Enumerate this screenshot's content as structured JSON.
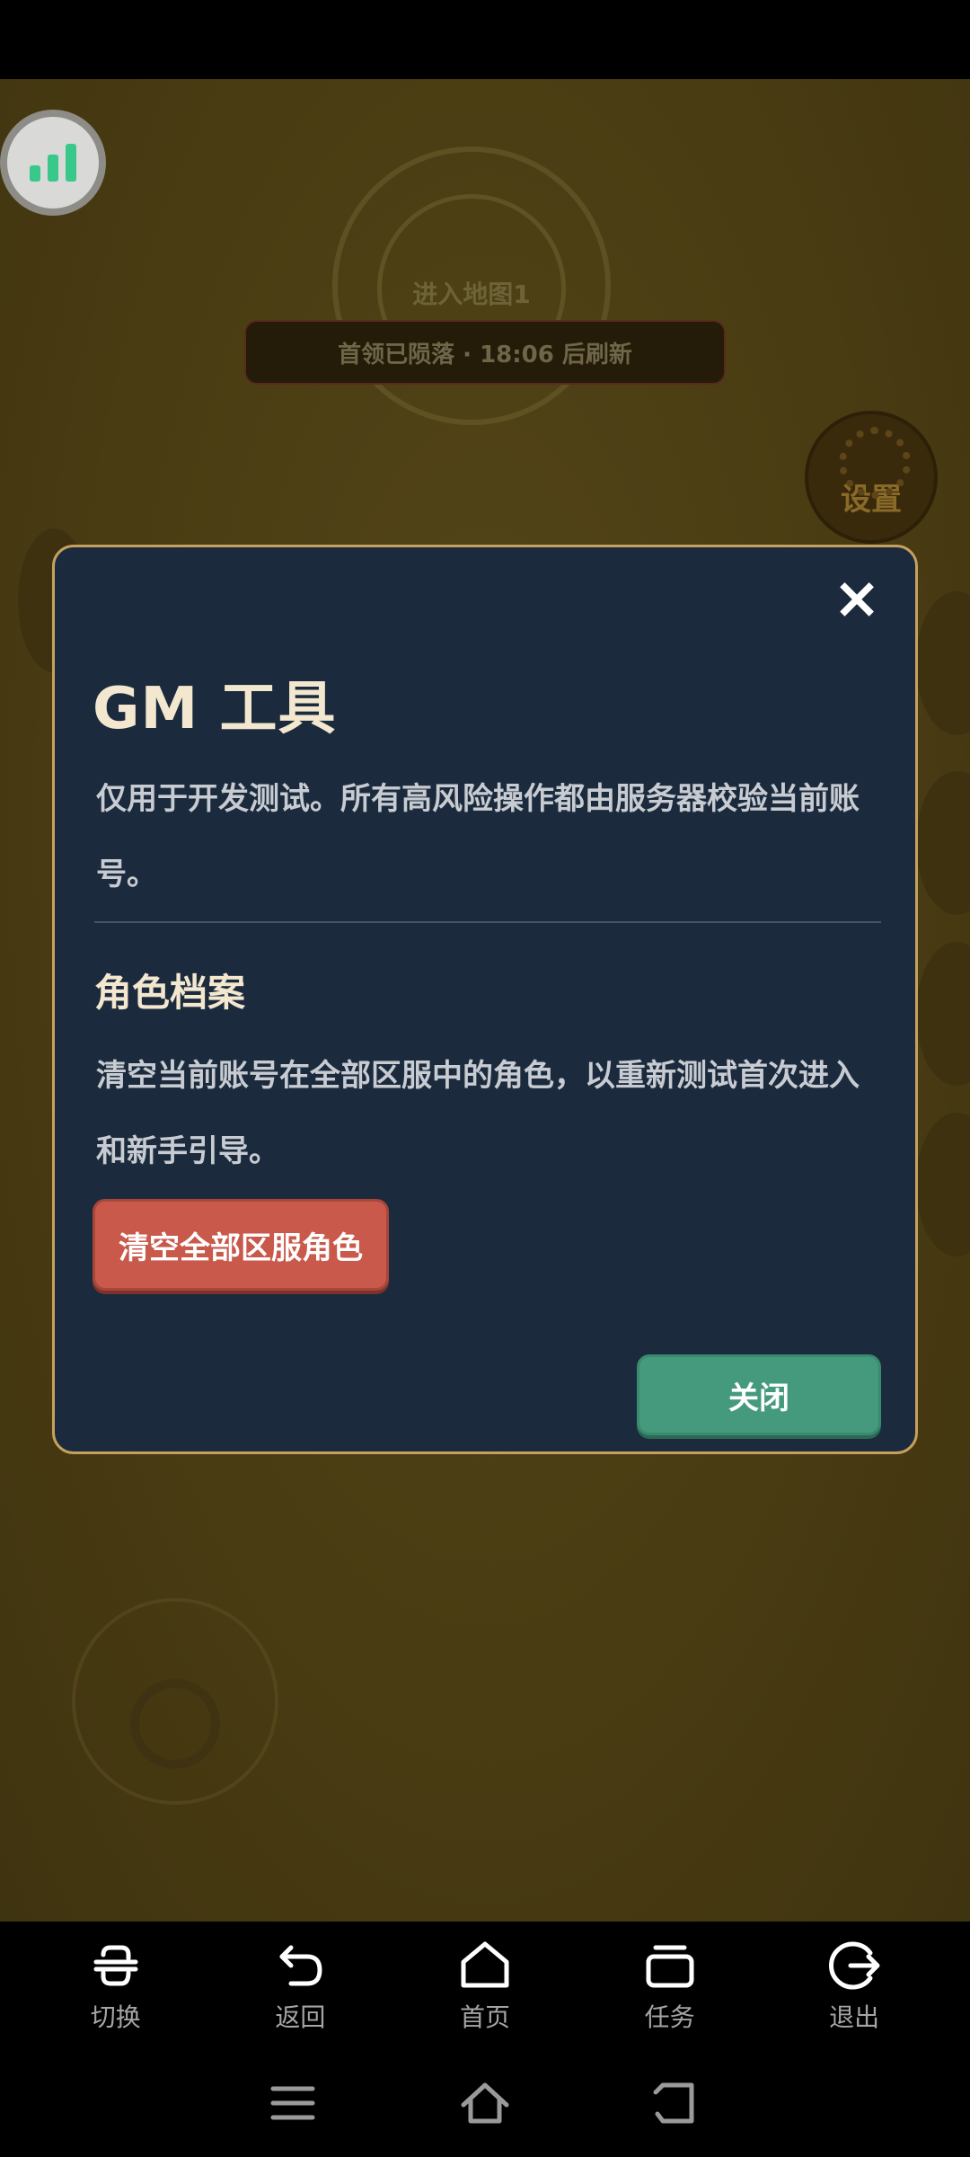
{
  "game": {
    "map_title": "进入地图1",
    "boss_banner": "首领已陨落 · 18:06 后刷新",
    "settings_label": "设置"
  },
  "dialog": {
    "title": "GM 工具",
    "description": "仅用于开发测试。所有高风险操作都由服务器校验当前账号。",
    "close_icon": "×",
    "section_title": "角色档案",
    "section_description": "清空当前账号在全部区服中的角色，以重新测试首次进入和新手引导。",
    "danger_button_label": "清空全部区服角色",
    "close_button_label": "关闭"
  },
  "toolbar": {
    "items": [
      {
        "label": "切换",
        "icon": "switch-icon"
      },
      {
        "label": "返回",
        "icon": "back-icon"
      },
      {
        "label": "首页",
        "icon": "home-icon"
      },
      {
        "label": "任务",
        "icon": "tasks-icon"
      },
      {
        "label": "退出",
        "icon": "exit-icon"
      }
    ]
  },
  "colors": {
    "dialog_bg": "#1b2b3d",
    "dialog_border": "#c6a15e",
    "danger": "#c8594b",
    "primary": "#459a7e"
  }
}
